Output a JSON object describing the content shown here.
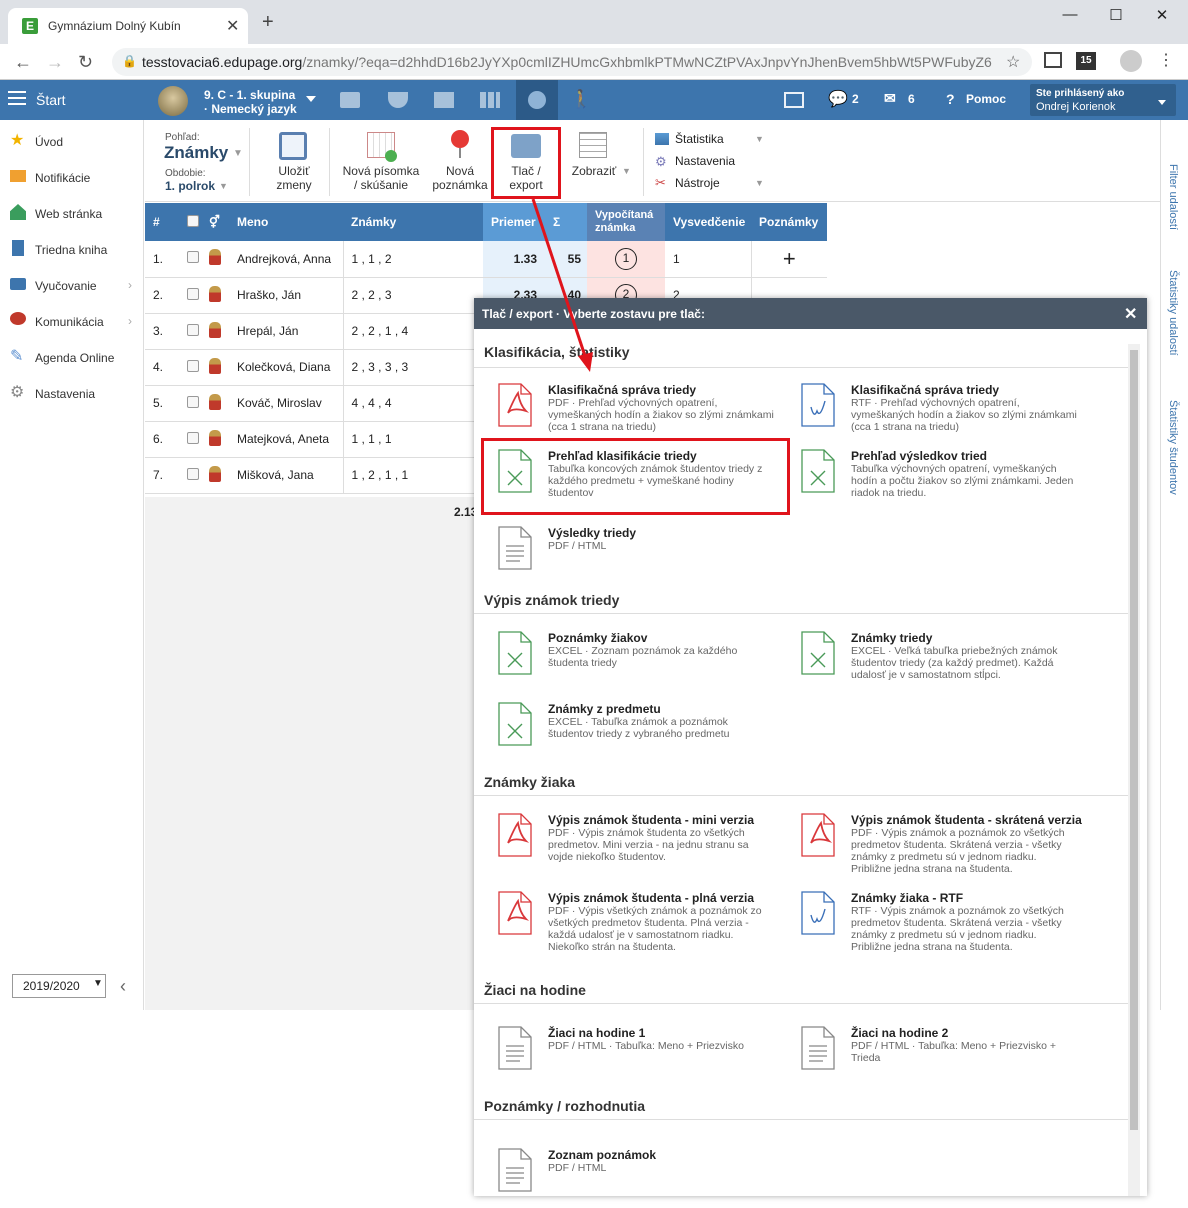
{
  "browser": {
    "tab_title": "Gymnázium Dolný Kubín",
    "favicon": "E",
    "url_host": "tesstovacia6.edupage.org",
    "url_path": "/znamky/?eqa=d2hhdD16b2JyYXp0cmlIZHUmcGxhbmlkPTMwNCZtPVAxJnpvYnJhenBvem5hbWt5PWFubyZ6b...",
    "badge": "15"
  },
  "header": {
    "start": "Štart",
    "class_line1": "9. C - 1. skupina",
    "class_line2": "· Nemecký jazyk",
    "messages_count": "2",
    "mail_count": "6",
    "help": "Pomoc",
    "logged_as": "Ste prihlásený ako",
    "user_name": "Ondrej Korienok"
  },
  "sidebar": {
    "items": [
      {
        "label": "Úvod",
        "icon": "star-icon",
        "color": "#f2b400"
      },
      {
        "label": "Notifikácie",
        "icon": "envelope-icon",
        "color": "#f0a030"
      },
      {
        "label": "Web stránka",
        "icon": "house-icon",
        "color": "#3a9d5d"
      },
      {
        "label": "Triedna kniha",
        "icon": "book-icon",
        "color": "#3d75ad"
      },
      {
        "label": "Vyučovanie",
        "icon": "open-book-icon",
        "color": "#3d75ad"
      },
      {
        "label": "Komunikácia",
        "icon": "chat-icon",
        "color": "#c0392b"
      },
      {
        "label": "Agenda Online",
        "icon": "pen-icon",
        "color": "#5b8fd0"
      },
      {
        "label": "Nastavenia",
        "icon": "gear-icon",
        "color": "#888888"
      }
    ],
    "year": "2019/2020"
  },
  "toolbar": {
    "view_label": "Pohľad:",
    "view_value": "Známky",
    "period_label": "Obdobie:",
    "period_value": "1. polrok",
    "save": "Uložiť\nzmeny",
    "new_test": "Nová písomka\n/ skúšanie",
    "new_note": "Nová\npoznámka",
    "print": "Tlač /\nexport",
    "show": "Zobraziť",
    "statistics": "Štatistika",
    "settings": "Nastavenia",
    "tools": "Nástroje"
  },
  "grid": {
    "headers": [
      "#",
      "",
      "",
      "Meno",
      "Známky",
      "Priemer",
      "Σ",
      "Vypočítaná známka",
      "Vysvedčenie",
      "Poznámky"
    ],
    "rows": [
      {
        "n": "1.",
        "name": "Andrejková, Anna",
        "grades": "1 , 1 , 2",
        "avg": "1.33",
        "sum": "55",
        "calc": "1",
        "cert": "1"
      },
      {
        "n": "2.",
        "name": "Hraško, Ján",
        "grades": "2 , 2 , 3",
        "avg": "2.33",
        "sum": "40",
        "calc": "2",
        "cert": "2"
      },
      {
        "n": "3.",
        "name": "Hrepál, Ján",
        "grades": "2 , 2 , 1 , 4",
        "avg": "",
        "sum": "",
        "calc": "",
        "cert": ""
      },
      {
        "n": "4.",
        "name": "Kolečková, Diana",
        "grades": "2 , 3 , 3 , 3",
        "avg": "",
        "sum": "",
        "calc": "",
        "cert": ""
      },
      {
        "n": "5.",
        "name": "Kováč, Miroslav",
        "grades": "4 , 4 , 4",
        "avg": "",
        "sum": "",
        "calc": "",
        "cert": ""
      },
      {
        "n": "6.",
        "name": "Matejková, Aneta",
        "grades": "1 , 1 , 1",
        "avg": "",
        "sum": "",
        "calc": "",
        "cert": ""
      },
      {
        "n": "7.",
        "name": "Mišková, Jana",
        "grades": "1 , 2 , 1 , 1",
        "avg": "",
        "sum": "",
        "calc": "",
        "cert": ""
      }
    ],
    "class_avg": "2.13"
  },
  "rail": {
    "filter": "Filter udalostí",
    "event_stats": "Štatistiky udalostí",
    "student_stats": "Štatistiky študentov"
  },
  "dialog": {
    "title": "Tlač / export · Vyberte zostavu pre tlač:",
    "sections": [
      {
        "title": "Klasifikácia, štatistiky",
        "reports": [
          {
            "title": "Klasifikačná správa triedy",
            "desc": "PDF · Prehľad výchovných opatrení, vymeškaných hodín a žiakov so zlými známkami (cca 1 strana na triedu)",
            "type": "pdf"
          },
          {
            "title": "Klasifikačná správa triedy",
            "desc": "RTF · Prehľad výchovných opatrení, vymeškaných hodín a žiakov so zlými známkami (cca 1 strana na triedu)",
            "type": "rtf"
          },
          {
            "title": "Prehľad klasifikácie triedy",
            "desc": "Tabuľka koncových známok študentov triedy z každého predmetu + vymeškané hodiny študentov",
            "type": "xls"
          },
          {
            "title": "Prehľad výsledkov tried",
            "desc": "Tabuľka výchovných opatrení, vymeškaných hodín a počtu žiakov so zlými známkami. Jeden riadok na triedu.",
            "type": "xls"
          },
          {
            "title": "Výsledky triedy",
            "desc": "PDF / HTML",
            "type": "doc"
          }
        ]
      },
      {
        "title": "Výpis známok triedy",
        "reports": [
          {
            "title": "Poznámky žiakov",
            "desc": "EXCEL · Zoznam poznámok za každého študenta triedy",
            "type": "xls"
          },
          {
            "title": "Známky triedy",
            "desc": "EXCEL · Veľká tabuľka priebežných známok študentov triedy (za každý predmet). Každá udalosť je v samostatnom stĺpci.",
            "type": "xls"
          },
          {
            "title": "Známky z predmetu",
            "desc": "EXCEL · Tabuľka známok a poznámok študentov triedy z vybraného predmetu",
            "type": "xls"
          }
        ]
      },
      {
        "title": "Známky žiaka",
        "reports": [
          {
            "title": "Výpis známok študenta - mini verzia",
            "desc": "PDF · Výpis známok študenta zo všetkých predmetov. Mini verzia - na jednu stranu sa vojde niekoľko študentov.",
            "type": "pdf"
          },
          {
            "title": "Výpis známok študenta - skrátená verzia",
            "desc": "PDF · Výpis známok a poznámok zo všetkých predmetov študenta. Skrátená verzia - všetky známky z predmetu sú v jednom riadku. Približne jedna strana na študenta.",
            "type": "pdf"
          },
          {
            "title": "Výpis známok študenta - plná verzia",
            "desc": "PDF · Výpis všetkých známok a poznámok zo všetkých predmetov študenta. Plná verzia - každá udalosť je v samostatnom riadku. Niekoľko strán na študenta.",
            "type": "pdf"
          },
          {
            "title": "Známky žiaka - RTF",
            "desc": "RTF · Výpis známok a poznámok zo všetkých predmetov študenta. Skrátená verzia - všetky známky z predmetu sú v jednom riadku. Približne jedna strana na študenta.",
            "type": "rtf"
          }
        ]
      },
      {
        "title": "Žiaci na hodine",
        "reports": [
          {
            "title": "Žiaci na hodine 1",
            "desc": "PDF / HTML · Tabuľka: Meno + Priezvisko",
            "type": "doc"
          },
          {
            "title": "Žiaci na hodine 2",
            "desc": "PDF / HTML · Tabuľka: Meno + Priezvisko + Trieda",
            "type": "doc"
          }
        ]
      },
      {
        "title": "Poznámky / rozhodnutia",
        "reports": [
          {
            "title": "Zoznam poznámok",
            "desc": "PDF / HTML",
            "type": "doc"
          }
        ]
      }
    ]
  },
  "colors": {
    "header": "#3d75ad",
    "highlight": "#e0141c",
    "pdf": "#d9383b",
    "xls": "#4a9a58",
    "rtf": "#3a6fb8"
  }
}
